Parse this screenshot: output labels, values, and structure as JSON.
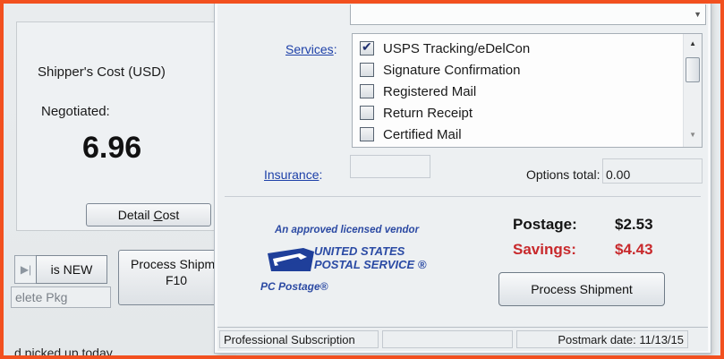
{
  "background_window": {
    "shipper_cost_label": "Shipper's Cost (USD)",
    "negotiated_label": "Negotiated:",
    "cost_value": "6.96",
    "detail_cost_prefix": "Detail ",
    "detail_cost_underlined": "C",
    "detail_cost_suffix": "ost",
    "media_icon": "skip-next-icon",
    "is_new_label": "is NEW",
    "delete_pkg_label": "elete Pkg",
    "process_shipment_line1": "Process Shipme",
    "process_shipment_line2": "F10",
    "picked_up_text": "d picked up today"
  },
  "dialog": {
    "services_label": "Services",
    "services_colon": ":",
    "services": [
      {
        "label": "USPS Tracking/eDelCon",
        "checked": true
      },
      {
        "label": "Signature Confirmation",
        "checked": false
      },
      {
        "label": "Registered Mail",
        "checked": false
      },
      {
        "label": "Return Receipt",
        "checked": false
      },
      {
        "label": "Certified Mail",
        "checked": false
      }
    ],
    "insurance_label": "Insurance",
    "insurance_colon": ":",
    "options_total_label": "Options total:",
    "options_total_value": "0.00",
    "vendor_text": "An approved licensed vendor",
    "usps_line1": "UNITED STATES",
    "usps_line2": "POSTAL SERVICE ®",
    "pc_postage": "PC Postage®",
    "postage_label": "Postage:",
    "postage_value": "$2.53",
    "savings_label": "Savings:",
    "savings_value": "$4.43",
    "process_button": "Process Shipment",
    "status_subscription": "Professional Subscription",
    "status_postmark": "Postmark date: 11/13/15"
  },
  "colors": {
    "frame_border": "#f2501f",
    "link_blue": "#1d40a8",
    "savings_red": "#c8292c",
    "usps_blue": "#2a4aa4"
  }
}
